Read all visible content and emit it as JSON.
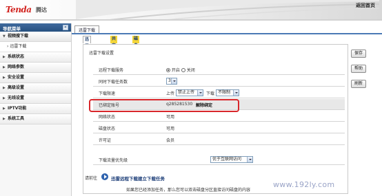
{
  "header": {
    "logo_text": "Tenda",
    "logo_cn": "腾达",
    "home_link": "返回首页"
  },
  "nav": {
    "title": "导航菜单",
    "collapse_icon": "«",
    "items": [
      {
        "label": "视频搜下载",
        "open": true,
        "subitems": [
          "迅雷下载"
        ]
      },
      {
        "label": "系统状态"
      },
      {
        "label": "网络参数"
      },
      {
        "label": "安全设置"
      },
      {
        "label": "高级设置"
      },
      {
        "label": "无线设置"
      },
      {
        "label": "IPTV功能"
      },
      {
        "label": "系统工具"
      }
    ]
  },
  "content": {
    "top_tab": "迅雷下载",
    "sub_tabs": [
      "迅雷下载",
      "共享存储",
      "磁盘日志"
    ],
    "panel_title": "迅雷下载设置",
    "rows": {
      "remote_service": {
        "label": "远程下载服务",
        "on": "开启",
        "off": "关闭",
        "selected": "on"
      },
      "concurrent": {
        "label": "同时下载任务数",
        "value": "3"
      },
      "speed": {
        "label": "下载限速",
        "upload_label": "上传",
        "upload_value": "禁止上传",
        "download_label": "下载",
        "download_value": "不限制"
      },
      "bound_account": {
        "label": "已绑定账号",
        "value": "q285281530",
        "action": "解除绑定"
      },
      "network_status": {
        "label": "网络状态",
        "value": "可用"
      },
      "disk_status": {
        "label": "磁盘状态",
        "value": "可用"
      },
      "license": {
        "label": "许可证",
        "value": "会员"
      },
      "priority": {
        "label": "下载流量优先级",
        "value": "优于互联网访问"
      }
    },
    "buttons": {
      "save": "保存",
      "help": "帮助",
      "refresh": "刷新"
    },
    "note": {
      "label": "请前往",
      "link": "迅雷远程下载建立下载任务",
      "text": "如果您已经添加任务，那么您可以双击磁盘分区直接访问磁盘的内容"
    }
  },
  "watermark": "www.192ly.com",
  "colors": {
    "accent": "#26507f",
    "highlight": "#d8262b",
    "tab_yellow": "#f4d63a"
  }
}
